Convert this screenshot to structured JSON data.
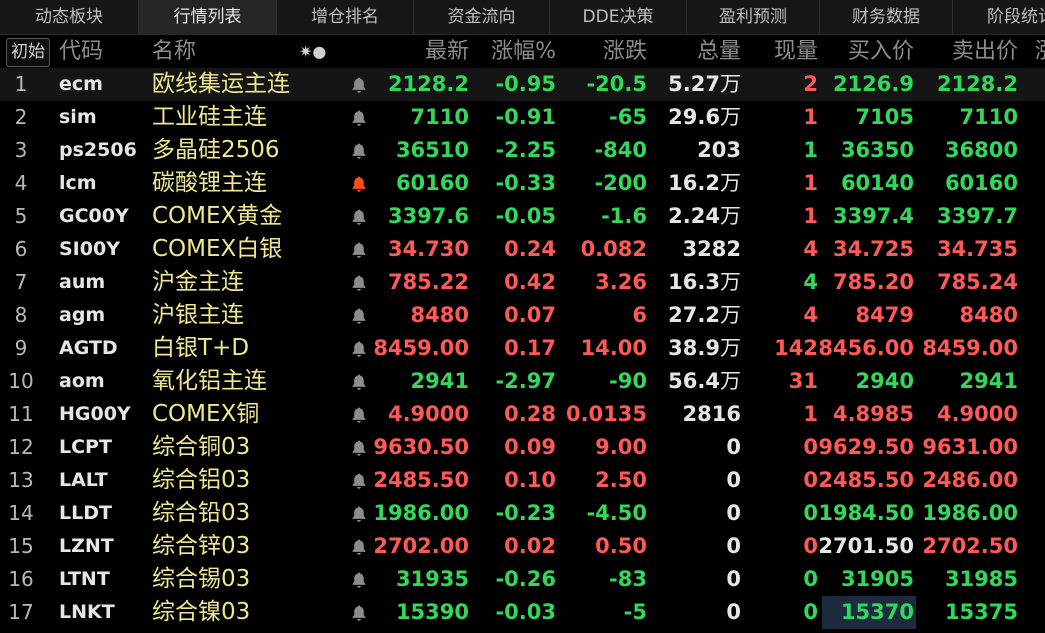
{
  "tabs": [
    "动态板块",
    "行情列表",
    "增仓排名",
    "资金流向",
    "DDE决策",
    "盈利预测",
    "财务数据",
    "阶段统计"
  ],
  "active_tab": 1,
  "header": {
    "init_button": "初始",
    "code": "代码",
    "name": "名称",
    "icons": "✷●",
    "last": "最新",
    "pct": "涨幅%",
    "change": "涨跌",
    "volume": "总量",
    "current": "现量",
    "bid": "买入价",
    "ask": "卖出价",
    "extra": "涨"
  },
  "colors": {
    "up": "#ff5858",
    "down": "#31d85c",
    "name": "#efe88e",
    "bell_active": "#ff4d1a",
    "bell": "#8c8c8c"
  },
  "rows": [
    {
      "idx": "1",
      "code": "ecm",
      "name": "欧线集运主连",
      "alert": false,
      "last": "2128.2",
      "pct": "-0.95",
      "change": "-20.5",
      "volume": "5.27",
      "volume_unit": "万",
      "current": "2",
      "bid": "2126.9",
      "ask": "2128.2",
      "dir": "down",
      "current_dir": "up",
      "bid_dir": "down",
      "ask_dir": "down"
    },
    {
      "idx": "2",
      "code": "sim",
      "name": "工业硅主连",
      "alert": false,
      "last": "7110",
      "pct": "-0.91",
      "change": "-65",
      "volume": "29.6",
      "volume_unit": "万",
      "current": "1",
      "bid": "7105",
      "ask": "7110",
      "dir": "down",
      "current_dir": "up",
      "bid_dir": "down",
      "ask_dir": "down"
    },
    {
      "idx": "3",
      "code": "ps2506",
      "name": "多晶硅2506",
      "alert": false,
      "last": "36510",
      "pct": "-2.25",
      "change": "-840",
      "volume": "203",
      "volume_unit": "",
      "current": "1",
      "bid": "36350",
      "ask": "36800",
      "dir": "down",
      "current_dir": "down",
      "bid_dir": "down",
      "ask_dir": "down"
    },
    {
      "idx": "4",
      "code": "lcm",
      "name": "碳酸锂主连",
      "alert": true,
      "last": "60160",
      "pct": "-0.33",
      "change": "-200",
      "volume": "16.2",
      "volume_unit": "万",
      "current": "1",
      "bid": "60140",
      "ask": "60160",
      "dir": "down",
      "current_dir": "up",
      "bid_dir": "down",
      "ask_dir": "down"
    },
    {
      "idx": "5",
      "code": "GC00Y",
      "name": "COMEX黄金",
      "alert": false,
      "last": "3397.6",
      "pct": "-0.05",
      "change": "-1.6",
      "volume": "2.24",
      "volume_unit": "万",
      "current": "1",
      "bid": "3397.4",
      "ask": "3397.7",
      "dir": "down",
      "current_dir": "up",
      "bid_dir": "down",
      "ask_dir": "down"
    },
    {
      "idx": "6",
      "code": "SI00Y",
      "name": "COMEX白银",
      "alert": false,
      "last": "34.730",
      "pct": "0.24",
      "change": "0.082",
      "volume": "3282",
      "volume_unit": "",
      "current": "4",
      "bid": "34.725",
      "ask": "34.735",
      "dir": "up",
      "current_dir": "up",
      "bid_dir": "up",
      "ask_dir": "up"
    },
    {
      "idx": "7",
      "code": "aum",
      "name": "沪金主连",
      "alert": false,
      "last": "785.22",
      "pct": "0.42",
      "change": "3.26",
      "volume": "16.3",
      "volume_unit": "万",
      "current": "4",
      "bid": "785.20",
      "ask": "785.24",
      "dir": "up",
      "current_dir": "down",
      "bid_dir": "up",
      "ask_dir": "up"
    },
    {
      "idx": "8",
      "code": "agm",
      "name": "沪银主连",
      "alert": false,
      "last": "8480",
      "pct": "0.07",
      "change": "6",
      "volume": "27.2",
      "volume_unit": "万",
      "current": "4",
      "bid": "8479",
      "ask": "8480",
      "dir": "up",
      "current_dir": "up",
      "bid_dir": "up",
      "ask_dir": "up"
    },
    {
      "idx": "9",
      "code": "AGTD",
      "name": "白银T+D",
      "alert": false,
      "last": "8459.00",
      "pct": "0.17",
      "change": "14.00",
      "volume": "38.9",
      "volume_unit": "万",
      "current": "142",
      "bid": "8456.00",
      "ask": "8459.00",
      "dir": "up",
      "current_dir": "up",
      "bid_dir": "up",
      "ask_dir": "up"
    },
    {
      "idx": "10",
      "code": "aom",
      "name": "氧化铝主连",
      "alert": false,
      "last": "2941",
      "pct": "-2.97",
      "change": "-90",
      "volume": "56.4",
      "volume_unit": "万",
      "current": "31",
      "bid": "2940",
      "ask": "2941",
      "dir": "down",
      "current_dir": "up",
      "bid_dir": "down",
      "ask_dir": "down"
    },
    {
      "idx": "11",
      "code": "HG00Y",
      "name": "COMEX铜",
      "alert": false,
      "last": "4.9000",
      "pct": "0.28",
      "change": "0.0135",
      "volume": "2816",
      "volume_unit": "",
      "current": "1",
      "bid": "4.8985",
      "ask": "4.9000",
      "dir": "up",
      "current_dir": "up",
      "bid_dir": "up",
      "ask_dir": "up"
    },
    {
      "idx": "12",
      "code": "LCPT",
      "name": "综合铜03",
      "alert": false,
      "last": "9630.50",
      "pct": "0.09",
      "change": "9.00",
      "volume": "0",
      "volume_unit": "",
      "current": "0",
      "bid": "9629.50",
      "ask": "9631.00",
      "dir": "up",
      "current_dir": "up",
      "bid_dir": "up",
      "ask_dir": "up"
    },
    {
      "idx": "13",
      "code": "LALT",
      "name": "综合铝03",
      "alert": false,
      "last": "2485.50",
      "pct": "0.10",
      "change": "2.50",
      "volume": "0",
      "volume_unit": "",
      "current": "0",
      "bid": "2485.50",
      "ask": "2486.00",
      "dir": "up",
      "current_dir": "up",
      "bid_dir": "up",
      "ask_dir": "up"
    },
    {
      "idx": "14",
      "code": "LLDT",
      "name": "综合铅03",
      "alert": false,
      "last": "1986.00",
      "pct": "-0.23",
      "change": "-4.50",
      "volume": "0",
      "volume_unit": "",
      "current": "0",
      "bid": "1984.50",
      "ask": "1986.00",
      "dir": "down",
      "current_dir": "down",
      "bid_dir": "down",
      "ask_dir": "down"
    },
    {
      "idx": "15",
      "code": "LZNT",
      "name": "综合锌03",
      "alert": false,
      "last": "2702.00",
      "pct": "0.02",
      "change": "0.50",
      "volume": "0",
      "volume_unit": "",
      "current": "0",
      "bid": "2701.50",
      "ask": "2702.50",
      "dir": "up",
      "current_dir": "up",
      "bid_dir": "white",
      "ask_dir": "up"
    },
    {
      "idx": "16",
      "code": "LTNT",
      "name": "综合锡03",
      "alert": false,
      "last": "31935",
      "pct": "-0.26",
      "change": "-83",
      "volume": "0",
      "volume_unit": "",
      "current": "0",
      "bid": "31905",
      "ask": "31985",
      "dir": "down",
      "current_dir": "down",
      "bid_dir": "down",
      "ask_dir": "down"
    },
    {
      "idx": "17",
      "code": "LNKT",
      "name": "综合镍03",
      "alert": false,
      "last": "15390",
      "pct": "-0.03",
      "change": "-5",
      "volume": "0",
      "volume_unit": "",
      "current": "0",
      "bid": "15370",
      "ask": "15375",
      "dir": "down",
      "current_dir": "down",
      "bid_dir": "down",
      "ask_dir": "down",
      "bid_highlight": true
    }
  ]
}
